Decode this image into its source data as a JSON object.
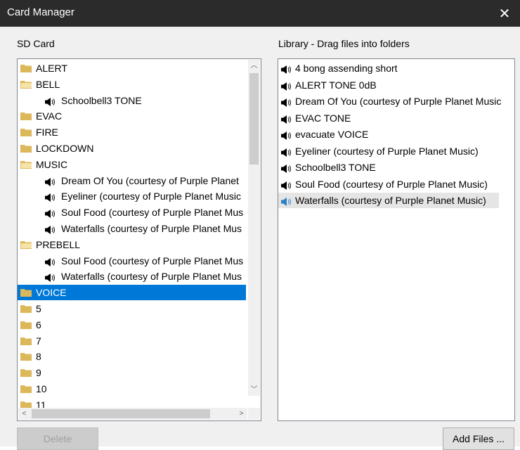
{
  "window": {
    "title": "Card Manager",
    "close_glyph": "✕"
  },
  "sd_card": {
    "label": "SD Card",
    "tree": [
      {
        "type": "folder",
        "label": "ALERT",
        "indent": 0
      },
      {
        "type": "folder-open",
        "label": "BELL",
        "indent": 0
      },
      {
        "type": "file",
        "label": "Schoolbell3 TONE",
        "indent": 1
      },
      {
        "type": "folder",
        "label": "EVAC",
        "indent": 0
      },
      {
        "type": "folder",
        "label": "FIRE",
        "indent": 0
      },
      {
        "type": "folder",
        "label": "LOCKDOWN",
        "indent": 0
      },
      {
        "type": "folder-open",
        "label": "MUSIC",
        "indent": 0
      },
      {
        "type": "file",
        "label": "Dream Of You (courtesy of Purple Planet",
        "indent": 1
      },
      {
        "type": "file",
        "label": "Eyeliner (courtesy of Purple Planet Music",
        "indent": 1
      },
      {
        "type": "file",
        "label": "Soul Food (courtesy of Purple Planet Mus",
        "indent": 1
      },
      {
        "type": "file",
        "label": "Waterfalls (courtesy of Purple Planet Mus",
        "indent": 1
      },
      {
        "type": "folder-open",
        "label": "PREBELL",
        "indent": 0
      },
      {
        "type": "file",
        "label": "Soul Food (courtesy of Purple Planet Mus",
        "indent": 1
      },
      {
        "type": "file",
        "label": "Waterfalls (courtesy of Purple Planet Mus",
        "indent": 1
      },
      {
        "type": "folder",
        "label": "VOICE",
        "indent": 0,
        "selected": true
      },
      {
        "type": "folder",
        "label": "5",
        "indent": 0
      },
      {
        "type": "folder",
        "label": "6",
        "indent": 0
      },
      {
        "type": "folder",
        "label": "7",
        "indent": 0
      },
      {
        "type": "folder",
        "label": "8",
        "indent": 0
      },
      {
        "type": "folder",
        "label": "9",
        "indent": 0
      },
      {
        "type": "folder",
        "label": "10",
        "indent": 0
      },
      {
        "type": "folder",
        "label": "11",
        "indent": 0
      }
    ],
    "delete_label": "Delete"
  },
  "library": {
    "label": "Library - Drag files into folders",
    "items": [
      {
        "label": "4 bong assending short"
      },
      {
        "label": "ALERT TONE 0dB"
      },
      {
        "label": "Dream Of You (courtesy of Purple Planet Music"
      },
      {
        "label": "EVAC TONE"
      },
      {
        "label": "evacuate VOICE"
      },
      {
        "label": "Eyeliner (courtesy of Purple Planet Music)"
      },
      {
        "label": "Schoolbell3 TONE"
      },
      {
        "label": "Soul Food (courtesy of Purple Planet Music)"
      },
      {
        "label": "Waterfalls (courtesy of Purple Planet Music)",
        "hover": true
      }
    ],
    "add_files_label": "Add Files ..."
  },
  "colors": {
    "selection": "#0078d7",
    "folder": "#dcb85a",
    "titlebar": "#2b2b2b"
  }
}
